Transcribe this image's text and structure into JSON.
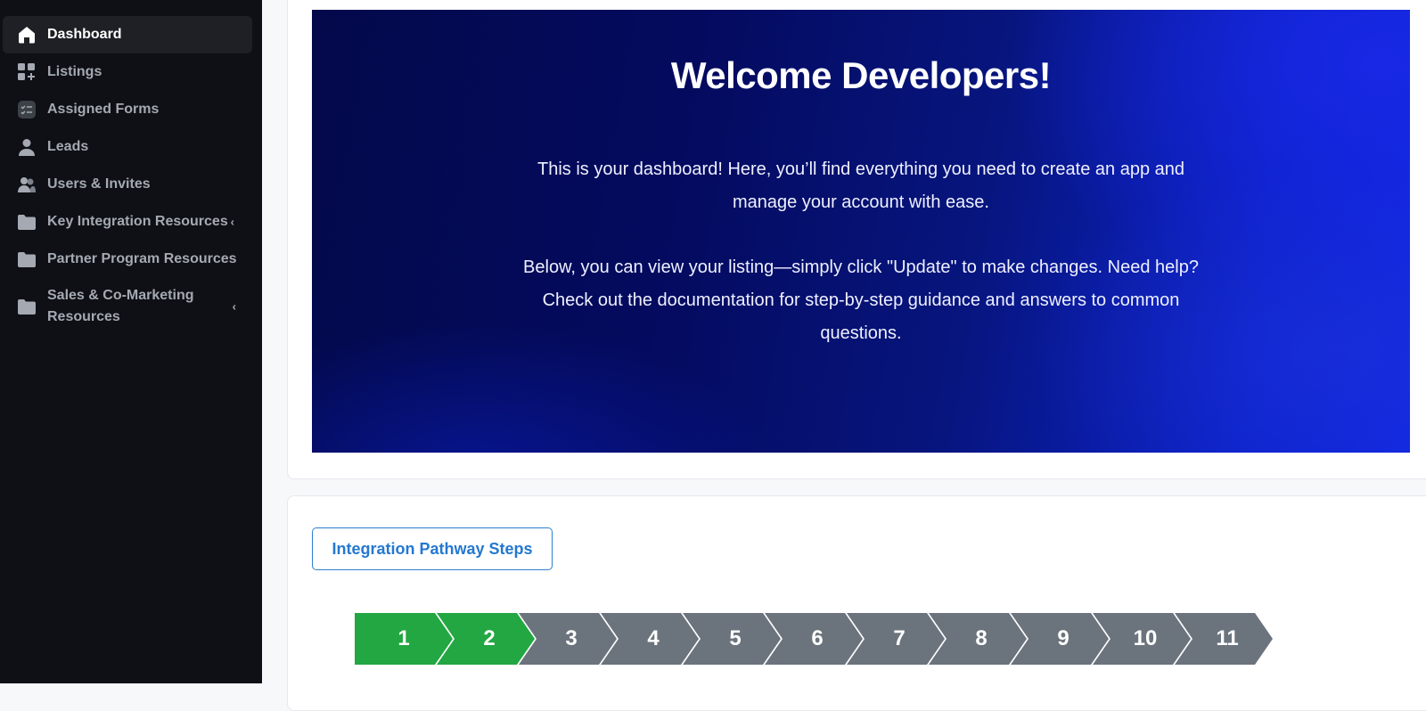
{
  "sidebar": {
    "items": [
      {
        "label": "Dashboard",
        "icon": "home-icon",
        "active": true
      },
      {
        "label": "Listings",
        "icon": "grid-plus-icon"
      },
      {
        "label": "Assigned Forms",
        "icon": "checklist-icon"
      },
      {
        "label": "Leads",
        "icon": "person-icon"
      },
      {
        "label": "Users & Invites",
        "icon": "users-icon"
      },
      {
        "label": "Key Integration Resources",
        "icon": "folder-icon",
        "chevron": "‹"
      },
      {
        "label": "Partner Program Resources",
        "icon": "folder-icon"
      },
      {
        "label": "Sales & Co-Marketing Resources",
        "icon": "folder-icon",
        "chevron": "‹"
      }
    ]
  },
  "hero": {
    "title": "Welcome Developers!",
    "paragraph1": "This is your dashboard! Here, you’ll find everything you need to create an app and manage your account with ease.",
    "paragraph2": "Below, you can view your listing—simply click \"Update\" to make changes. Need help? Check out the documentation for step-by-step guidance and answers to common questions."
  },
  "pathway": {
    "button_label": "Integration Pathway Steps",
    "steps": [
      "1",
      "2",
      "3",
      "4",
      "5",
      "6",
      "7",
      "8",
      "9",
      "10",
      "11"
    ],
    "completed_steps": 2,
    "colors": {
      "completed": "#23a742",
      "pending": "#6b747d"
    }
  }
}
